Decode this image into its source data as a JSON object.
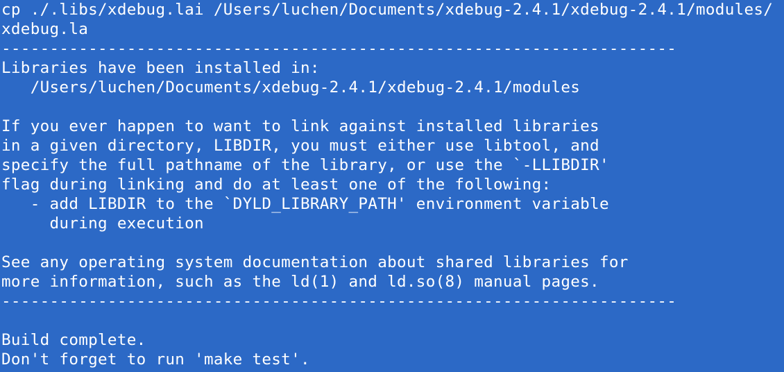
{
  "colors": {
    "background": "#2c69c6",
    "foreground": "#ffffff"
  },
  "terminal": {
    "lines": [
      "cp ./.libs/xdebug.lai /Users/luchen/Documents/xdebug-2.4.1/xdebug-2.4.1/modules/",
      "xdebug.la",
      "----------------------------------------------------------------------",
      "Libraries have been installed in:",
      "   /Users/luchen/Documents/xdebug-2.4.1/xdebug-2.4.1/modules",
      "",
      "If you ever happen to want to link against installed libraries",
      "in a given directory, LIBDIR, you must either use libtool, and",
      "specify the full pathname of the library, or use the `-LLIBDIR'",
      "flag during linking and do at least one of the following:",
      "   - add LIBDIR to the `DYLD_LIBRARY_PATH' environment variable",
      "     during execution",
      "",
      "See any operating system documentation about shared libraries for",
      "more information, such as the ld(1) and ld.so(8) manual pages.",
      "----------------------------------------------------------------------",
      "",
      "Build complete.",
      "Don't forget to run 'make test'."
    ]
  }
}
